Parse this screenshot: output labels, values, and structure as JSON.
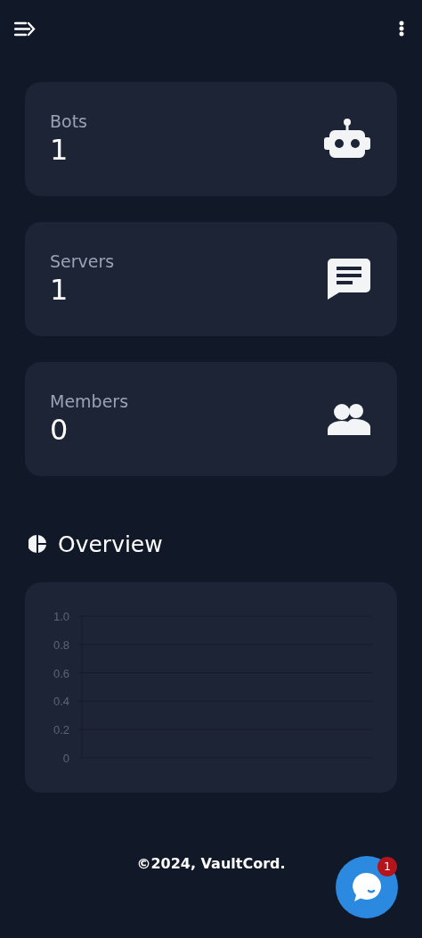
{
  "stats": [
    {
      "kind": "bot",
      "label": "Bots",
      "value": "1"
    },
    {
      "kind": "chat",
      "label": "Servers",
      "value": "1"
    },
    {
      "kind": "people",
      "label": "Members",
      "value": "0"
    }
  ],
  "overview": {
    "title": "Overview",
    "empty_chart": {
      "y_axis_labels": [
        "1.0",
        "0.8",
        "0.6",
        "0.4",
        "0.2",
        "0"
      ]
    }
  },
  "footer": "©2024, VaultCord.",
  "chat_badge": "1"
}
